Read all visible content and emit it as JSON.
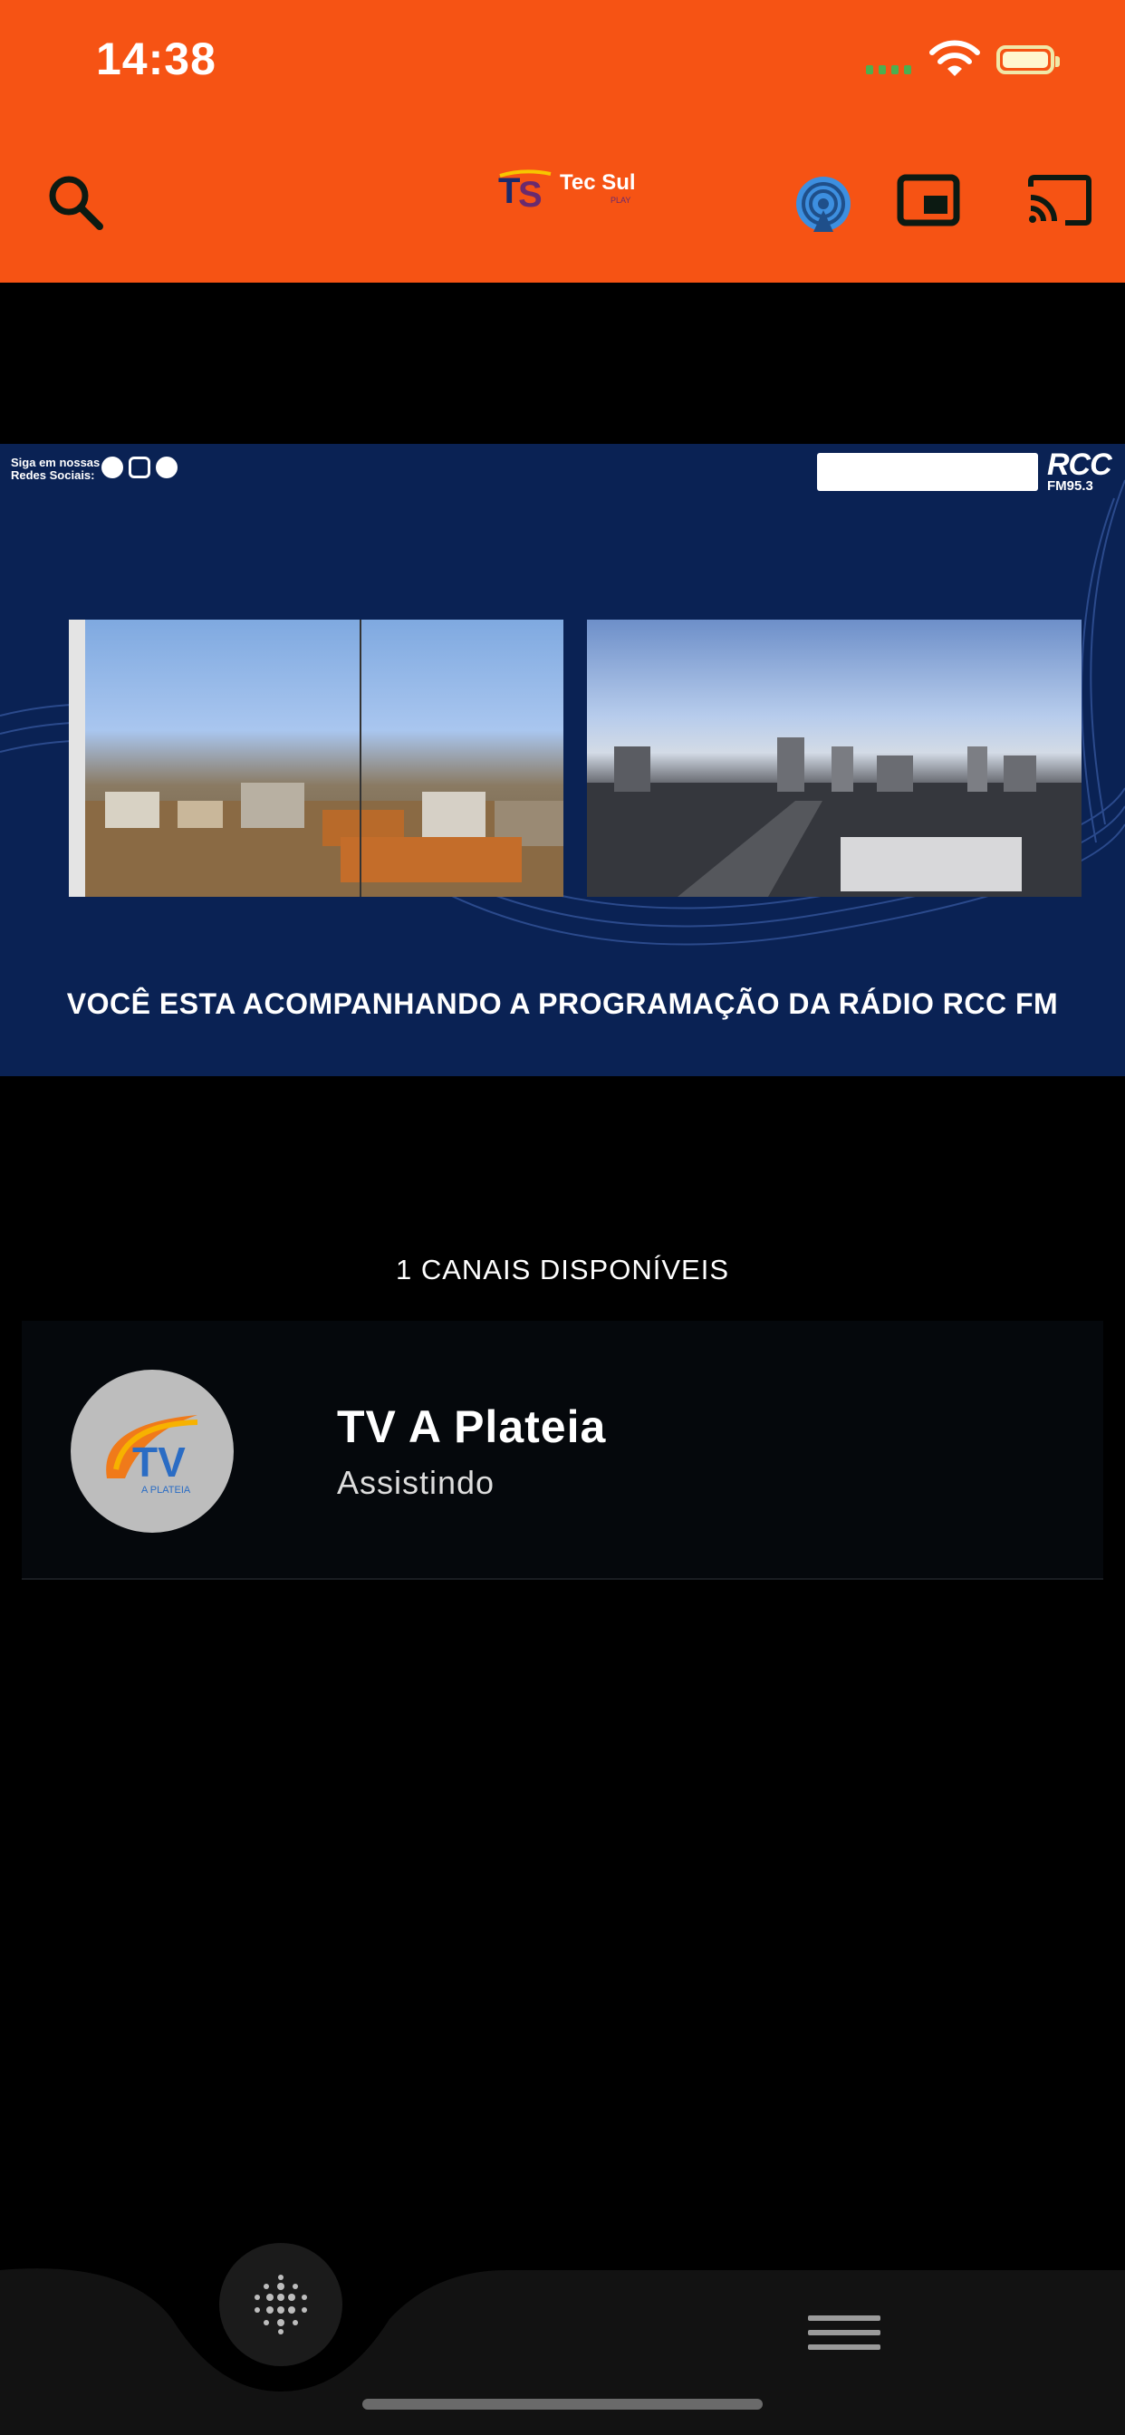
{
  "status_bar": {
    "time": "14:38"
  },
  "header": {
    "logo_text": "Tec Sul",
    "logo_sub": "PLAY",
    "icons": [
      "search-icon",
      "live-broadcast-icon",
      "picture-in-picture-icon",
      "cast-icon"
    ]
  },
  "player": {
    "social_label_line1": "Siga em nossas",
    "social_label_line2": "Redes Sociais:",
    "social_icons": [
      "facebook-icon",
      "instagram-icon",
      "spotify-icon"
    ],
    "station_logo": "RCC",
    "station_freq": "FM95.3",
    "caption": "VOCÊ ESTA ACOMPANHANDO A PROGRAMAÇÃO DA RÁDIO RCC FM"
  },
  "channels": {
    "title": "1 CANAIS DISPONÍVEIS",
    "items": [
      {
        "name": "TV A Plateia",
        "status": "Assistindo",
        "logo_text": "TV",
        "logo_sub": "A PLATEIA"
      }
    ]
  },
  "bottom_nav": {
    "icons": [
      "home-dots-icon",
      "menu-icon"
    ]
  },
  "colors": {
    "header_bg": "#f65314",
    "player_bg": "#0a2254",
    "card_bg": "#05080c",
    "nav_bg": "#121212"
  }
}
